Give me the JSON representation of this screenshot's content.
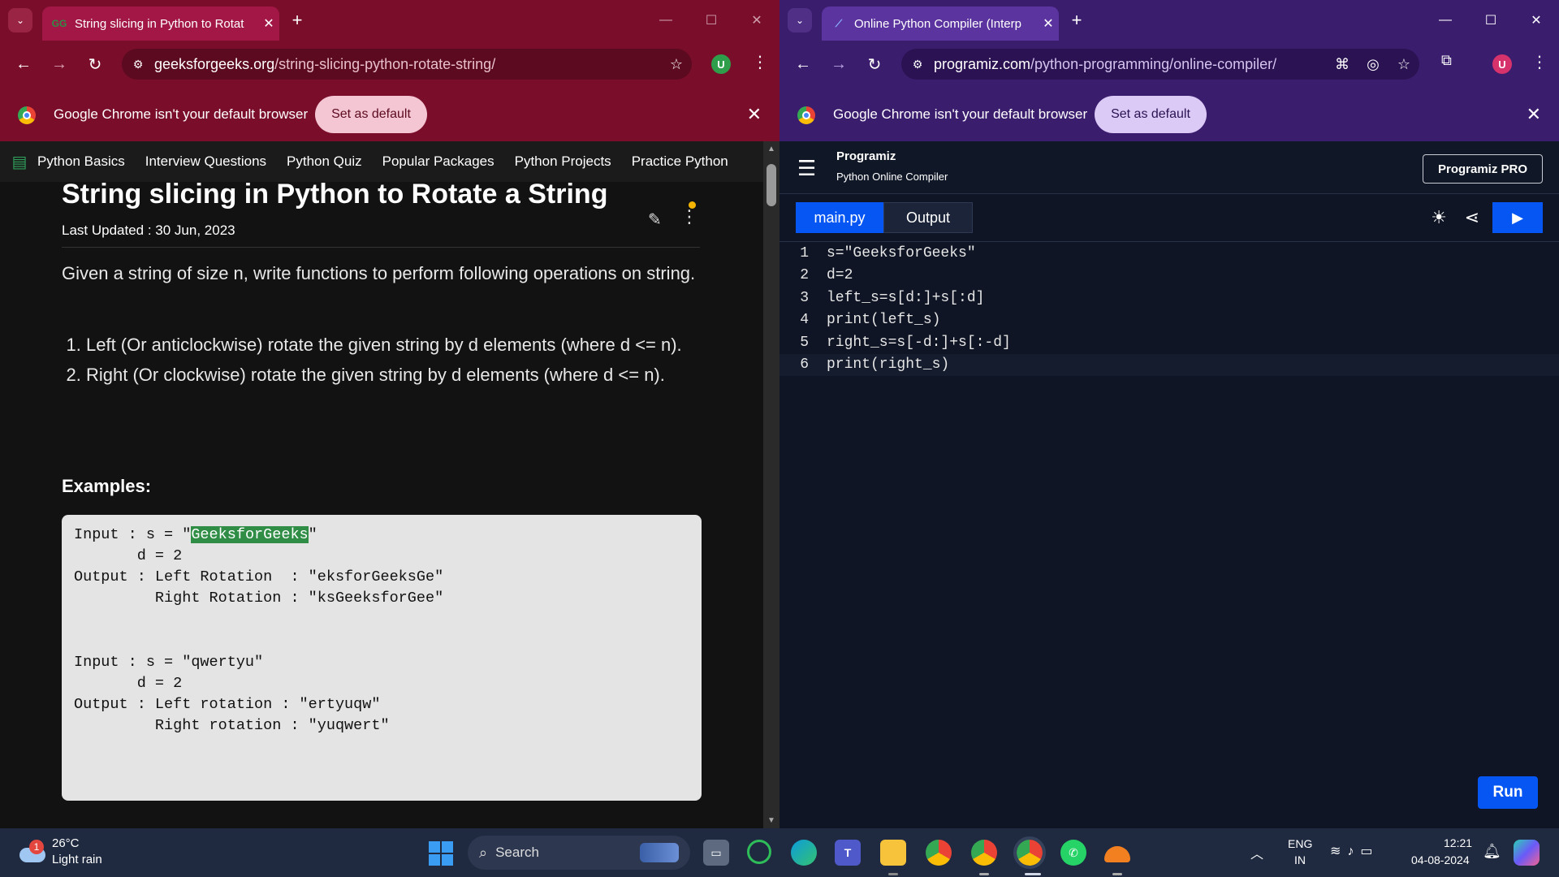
{
  "left": {
    "tab_title": "String slicing in Python to Rotat",
    "url_host": "geeksforgeeks.org",
    "url_path": "/string-slicing-python-rotate-string/",
    "avatar": "U",
    "info_text": "Google Chrome isn't your default browser",
    "set_default": "Set as default",
    "nav": [
      "Python Basics",
      "Interview Questions",
      "Python Quiz",
      "Popular Packages",
      "Python Projects",
      "Practice Python"
    ],
    "article": {
      "title": "String slicing in Python to Rotate a String",
      "updated": "Last Updated : 30 Jun, 2023",
      "intro": "Given a string of size n, write functions to perform following operations on string.",
      "list": [
        "Left (Or anticlockwise) rotate the given string by d elements (where d <= n).",
        "Right (Or clockwise) rotate the given string by d elements (where d <= n)."
      ],
      "examples_heading": "Examples:",
      "code": {
        "l1_pre": "Input : s = \"",
        "l1_hl": "GeeksforGeeks",
        "l1_post": "\"",
        "l2": "       d = 2",
        "l3": "Output : Left Rotation  : \"eksforGeeksGe\"",
        "l4": "         Right Rotation : \"ksGeeksforGee\"",
        "l5": "Input : s = \"qwertyu\"",
        "l6": "       d = 2",
        "l7": "Output : Left rotation : \"ertyuqw\"",
        "l8": "         Right rotation : \"yuqwert\""
      }
    }
  },
  "right": {
    "tab_title": "Online Python Compiler (Interp",
    "url_host": "programiz.com",
    "url_path": "/python-programming/online-compiler/",
    "avatar": "U",
    "info_text": "Google Chrome isn't your default browser",
    "set_default": "Set as default",
    "logo": "Programiz",
    "subtitle": "Python Online Compiler",
    "pro_button": "Programiz PRO",
    "tab_main": "main.py",
    "tab_output": "Output",
    "run_label": "Run",
    "code_lines": [
      {
        "n": "1",
        "t": "s=\"GeeksforGeeks\""
      },
      {
        "n": "2",
        "t": "d=2"
      },
      {
        "n": "3",
        "t": "left_s=s[d:]+s[:d]"
      },
      {
        "n": "4",
        "t": "print(left_s)"
      },
      {
        "n": "5",
        "t": "right_s=s[-d:]+s[:-d]"
      },
      {
        "n": "6",
        "t": "print(right_s)"
      }
    ]
  },
  "taskbar": {
    "weather_badge": "1",
    "temp": "26°C",
    "condition": "Light rain",
    "search": "Search",
    "lang1": "ENG",
    "lang2": "IN",
    "time": "12:21",
    "date": "04-08-2024"
  },
  "colors": {
    "gfg_green": "#2f8d46",
    "programiz_blue": "#0556f3",
    "left_frame": "#7a0e2a",
    "right_frame": "#3b1d6e"
  }
}
